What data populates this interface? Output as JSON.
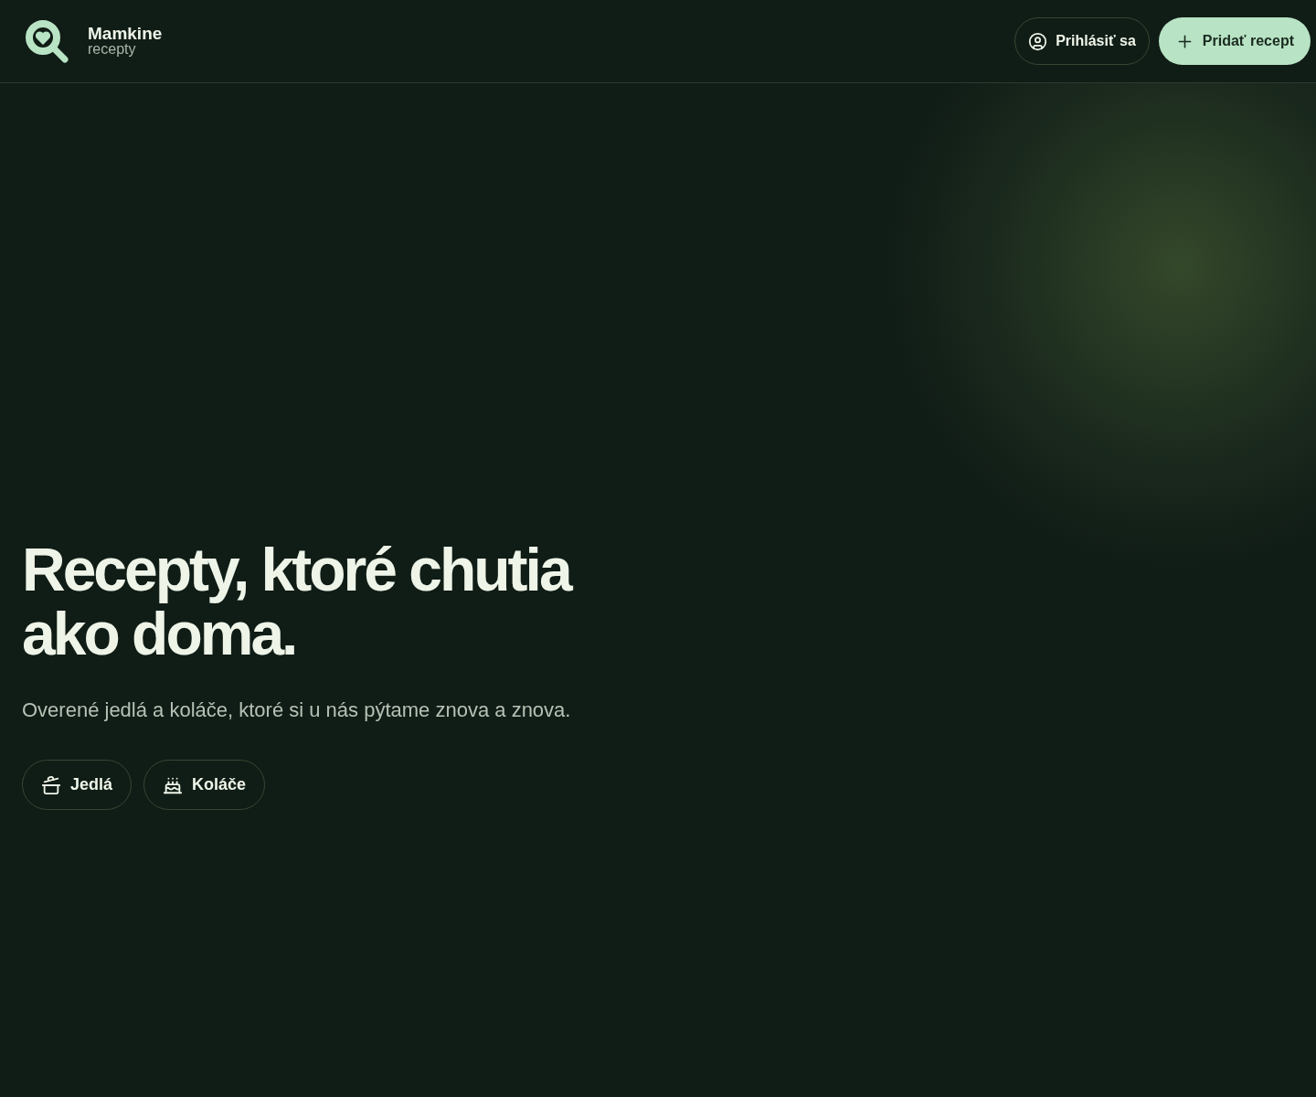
{
  "header": {
    "logo": {
      "name": "Mamkine",
      "subtitle": "recepty"
    },
    "buttons": [
      {
        "kind": "login",
        "label": "Prihlásiť sa"
      },
      {
        "kind": "add",
        "label": "Pridať recept"
      }
    ]
  },
  "hero": {
    "title_lines": [
      "Recepty, ktoré chutia",
      "ako doma."
    ],
    "subtitle": "Overené jedlá a koláče, ktoré si u nás pýtame znova a znova.",
    "categories": [
      {
        "kind": "meals",
        "label": "Jedlá"
      },
      {
        "kind": "cakes",
        "label": "Koláče"
      }
    ]
  }
}
